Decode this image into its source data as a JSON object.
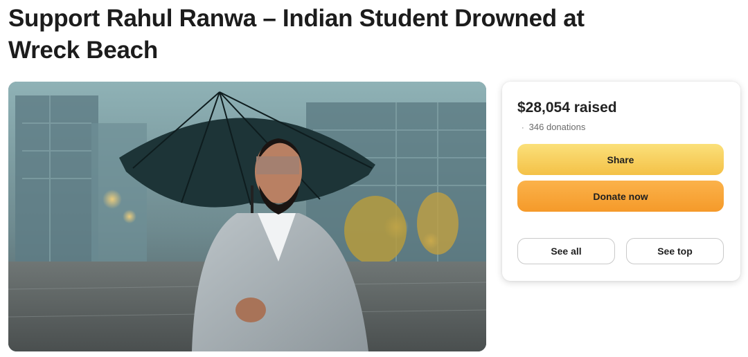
{
  "campaign": {
    "title": "Support Rahul Ranwa – Indian Student Drowned at Wreck Beach"
  },
  "hero_image": {
    "icon": "campaign-photo-man-with-umbrella"
  },
  "donation_card": {
    "amount_raised": "$28,054 raised",
    "donations_separator": "·",
    "donations_count": "346 donations",
    "share_label": "Share",
    "donate_label": "Donate now",
    "see_all_label": "See all",
    "see_top_label": "See top"
  },
  "colors": {
    "share_button": "#f6c94f",
    "donate_button": "#f7a43a",
    "outline_border": "#c9c9c9"
  }
}
